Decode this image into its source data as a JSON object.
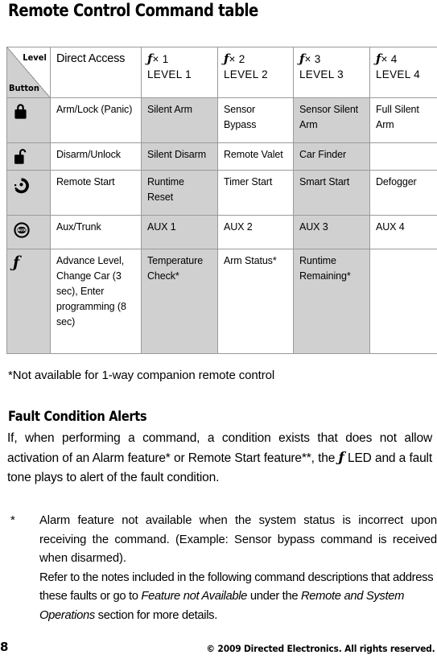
{
  "page_title": "Remote Control Command table",
  "table": {
    "corner": {
      "level_label": "Level",
      "button_label": "Button"
    },
    "headers": [
      {
        "id": "direct-access",
        "label": "Direct Access"
      },
      {
        "id": "level-1",
        "symbol": "ƒ",
        "multiplier": "× 1",
        "sub": "LEVEL 1"
      },
      {
        "id": "level-2",
        "symbol": "ƒ",
        "multiplier": "× 2",
        "sub": "LEVEL 2"
      },
      {
        "id": "level-3",
        "symbol": "ƒ",
        "multiplier": "× 3",
        "sub": "LEVEL 3"
      },
      {
        "id": "level-4",
        "symbol": "ƒ",
        "multiplier": "× 4",
        "sub": "LEVEL 4"
      }
    ],
    "rows": [
      {
        "icon": "padlock-closed-icon",
        "direct": "Arm/Lock (Panic)",
        "l1": "Silent Arm",
        "l2": "Sensor Bypass",
        "l3": "Sensor Silent Arm",
        "l4": "Full Silent Arm"
      },
      {
        "icon": "padlock-open-icon",
        "direct": "Disarm/Unlock",
        "l1": "Silent Disarm",
        "l2": "Remote Valet",
        "l3": "Car Finder",
        "l4": ""
      },
      {
        "icon": "remote-start-icon",
        "direct": "Remote Start",
        "l1": "Runtime Reset",
        "l2": "Timer Start",
        "l3": "Smart Start",
        "l4": "Defogger"
      },
      {
        "icon": "aux-trunk-icon",
        "direct": "Aux/Trunk",
        "l1": "AUX 1",
        "l2": "AUX 2",
        "l3": "AUX 3",
        "l4": "AUX 4"
      },
      {
        "icon": "function-f-icon",
        "direct": "Advance Level, Change Car (3 sec), Enter programming (8 sec)",
        "l1": "Temperature Check*",
        "l2": "Arm Status*",
        "l3": "Runtime Remaining*",
        "l4": ""
      }
    ]
  },
  "table_note": "*Not available for 1-way companion remote control",
  "section": {
    "heading": "Fault Condition Alerts",
    "paragraph_part1": "If, when performing a command, a condition exists that does not allow activation of an Alarm feature* or Remote Start feature**, the ",
    "paragraph_symbol": "ƒ",
    "paragraph_part2": " LED and a fault tone plays to alert of the fault condition."
  },
  "footnote": {
    "mark": "*",
    "paragraph1": "Alarm feature not available when the system status is incorrect upon receiving the command. (Example: Sensor bypass command is received when disarmed).",
    "p2_a": "Refer to the notes included in the following command descriptions that address these faults or go to ",
    "p2_italic1": "Feature not Available",
    "p2_b": " under the ",
    "p2_italic2": "Remote and System Operations",
    "p2_c": " section for more details."
  },
  "footer": {
    "page_number": "8",
    "copyright": "© 2009 Directed Electronics. All rights reserved."
  },
  "colors": {
    "shade_gray": "#d0d0d0",
    "border_gray": "#9a9a9a",
    "text": "#000000",
    "background": "#ffffff"
  }
}
